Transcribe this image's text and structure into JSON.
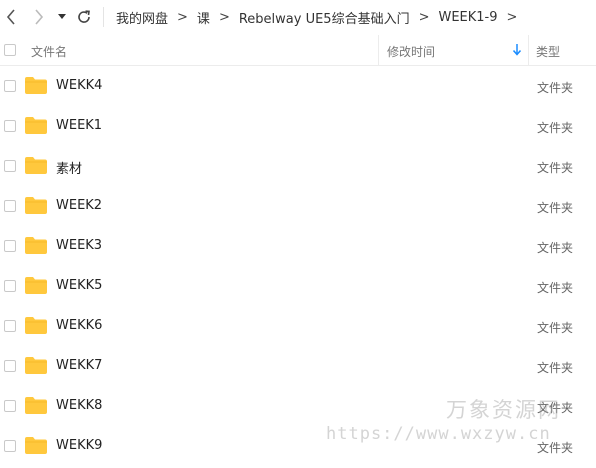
{
  "nav": {
    "back_icon": "chevron-left-icon",
    "forward_icon": "chevron-right-icon",
    "dropdown_icon": "caret-down-icon",
    "refresh_icon": "refresh-icon"
  },
  "breadcrumb": [
    "我的网盘",
    "课",
    "Rebelway UE5综合基础入门",
    "WEEK1-9"
  ],
  "breadcrumb_separator": ">",
  "header": {
    "name": "文件名",
    "modified": "修改时间",
    "type": "类型",
    "sort_icon": "arrow-down-icon"
  },
  "rows": [
    {
      "name": "WEKK4",
      "type": "文件夹"
    },
    {
      "name": "WEEK1",
      "type": "文件夹"
    },
    {
      "name": "素材",
      "type": "文件夹"
    },
    {
      "name": "WEEK2",
      "type": "文件夹"
    },
    {
      "name": "WEEK3",
      "type": "文件夹"
    },
    {
      "name": "WEKK5",
      "type": "文件夹"
    },
    {
      "name": "WEKK6",
      "type": "文件夹"
    },
    {
      "name": "WEKK7",
      "type": "文件夹"
    },
    {
      "name": "WEKK8",
      "type": "文件夹"
    },
    {
      "name": "WEKK9",
      "type": "文件夹"
    }
  ],
  "watermark": {
    "title": "万象资源网",
    "url": "https://www.wxzyw.cn"
  },
  "colors": {
    "folder": "#ffc83d",
    "sort_arrow": "#1a8cff"
  }
}
